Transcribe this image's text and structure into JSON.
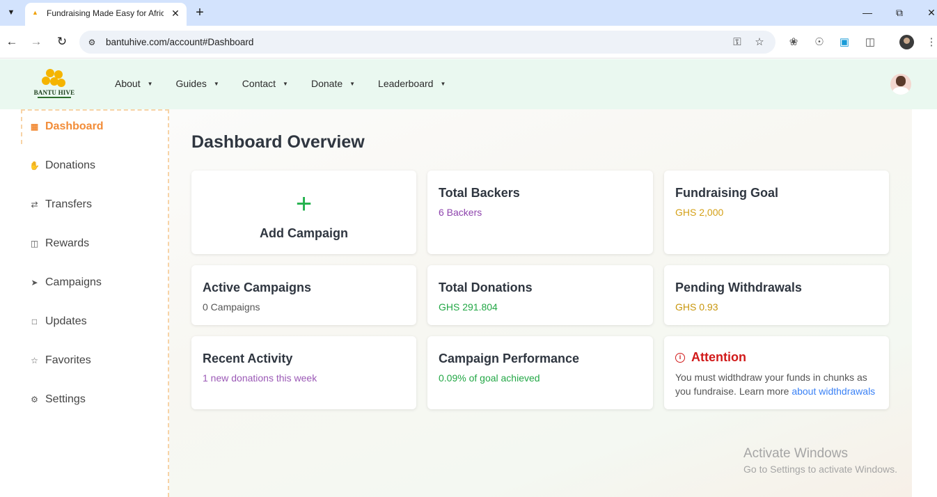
{
  "browser": {
    "tab_title": "Fundraising Made Easy for Afric",
    "url": "bantuhive.com/account#Dashboard"
  },
  "site": {
    "logo_text": "BANTU HIVE",
    "nav": [
      {
        "label": "About"
      },
      {
        "label": "Guides"
      },
      {
        "label": "Contact"
      },
      {
        "label": "Donate"
      },
      {
        "label": "Leaderboard"
      }
    ]
  },
  "sidebar": {
    "items": [
      {
        "label": "Dashboard",
        "icon": "grid-icon",
        "active": true
      },
      {
        "label": "Donations",
        "icon": "hand-icon"
      },
      {
        "label": "Transfers",
        "icon": "arrows-icon"
      },
      {
        "label": "Rewards",
        "icon": "gift-icon"
      },
      {
        "label": "Campaigns",
        "icon": "rocket-icon"
      },
      {
        "label": "Updates",
        "icon": "message-icon"
      },
      {
        "label": "Favorites",
        "icon": "star-icon"
      },
      {
        "label": "Settings",
        "icon": "gear-icon"
      }
    ]
  },
  "main": {
    "title": "Dashboard Overview",
    "add_campaign": {
      "label": "Add Campaign"
    },
    "cards": {
      "total_backers": {
        "title": "Total Backers",
        "value": "6 Backers",
        "color": "#8e44ad"
      },
      "fundraising_goal": {
        "title": "Fundraising Goal",
        "value": "GHS 2,000",
        "color": "#d4a017"
      },
      "active_campaigns": {
        "title": "Active Campaigns",
        "value": "0 Campaigns",
        "color": "#555555"
      },
      "total_donations": {
        "title": "Total Donations",
        "value": "GHS 291.804",
        "color": "#22a745"
      },
      "pending_withdrawals": {
        "title": "Pending Withdrawals",
        "value": "GHS 0.93",
        "color": "#c8960c"
      },
      "recent_activity": {
        "title": "Recent Activity",
        "value": "1 new donations this week",
        "color": "#9b59b6"
      },
      "campaign_performance": {
        "title": "Campaign Performance",
        "value": "0.09% of goal achieved",
        "color": "#22a745"
      }
    },
    "attention": {
      "title": "Attention",
      "body": "You must widthdraw your funds in chunks as you fundraise. Learn more ",
      "link": "about widthdrawals"
    }
  },
  "watermark": {
    "title": "Activate Windows",
    "subtitle": "Go to Settings to activate Windows."
  }
}
